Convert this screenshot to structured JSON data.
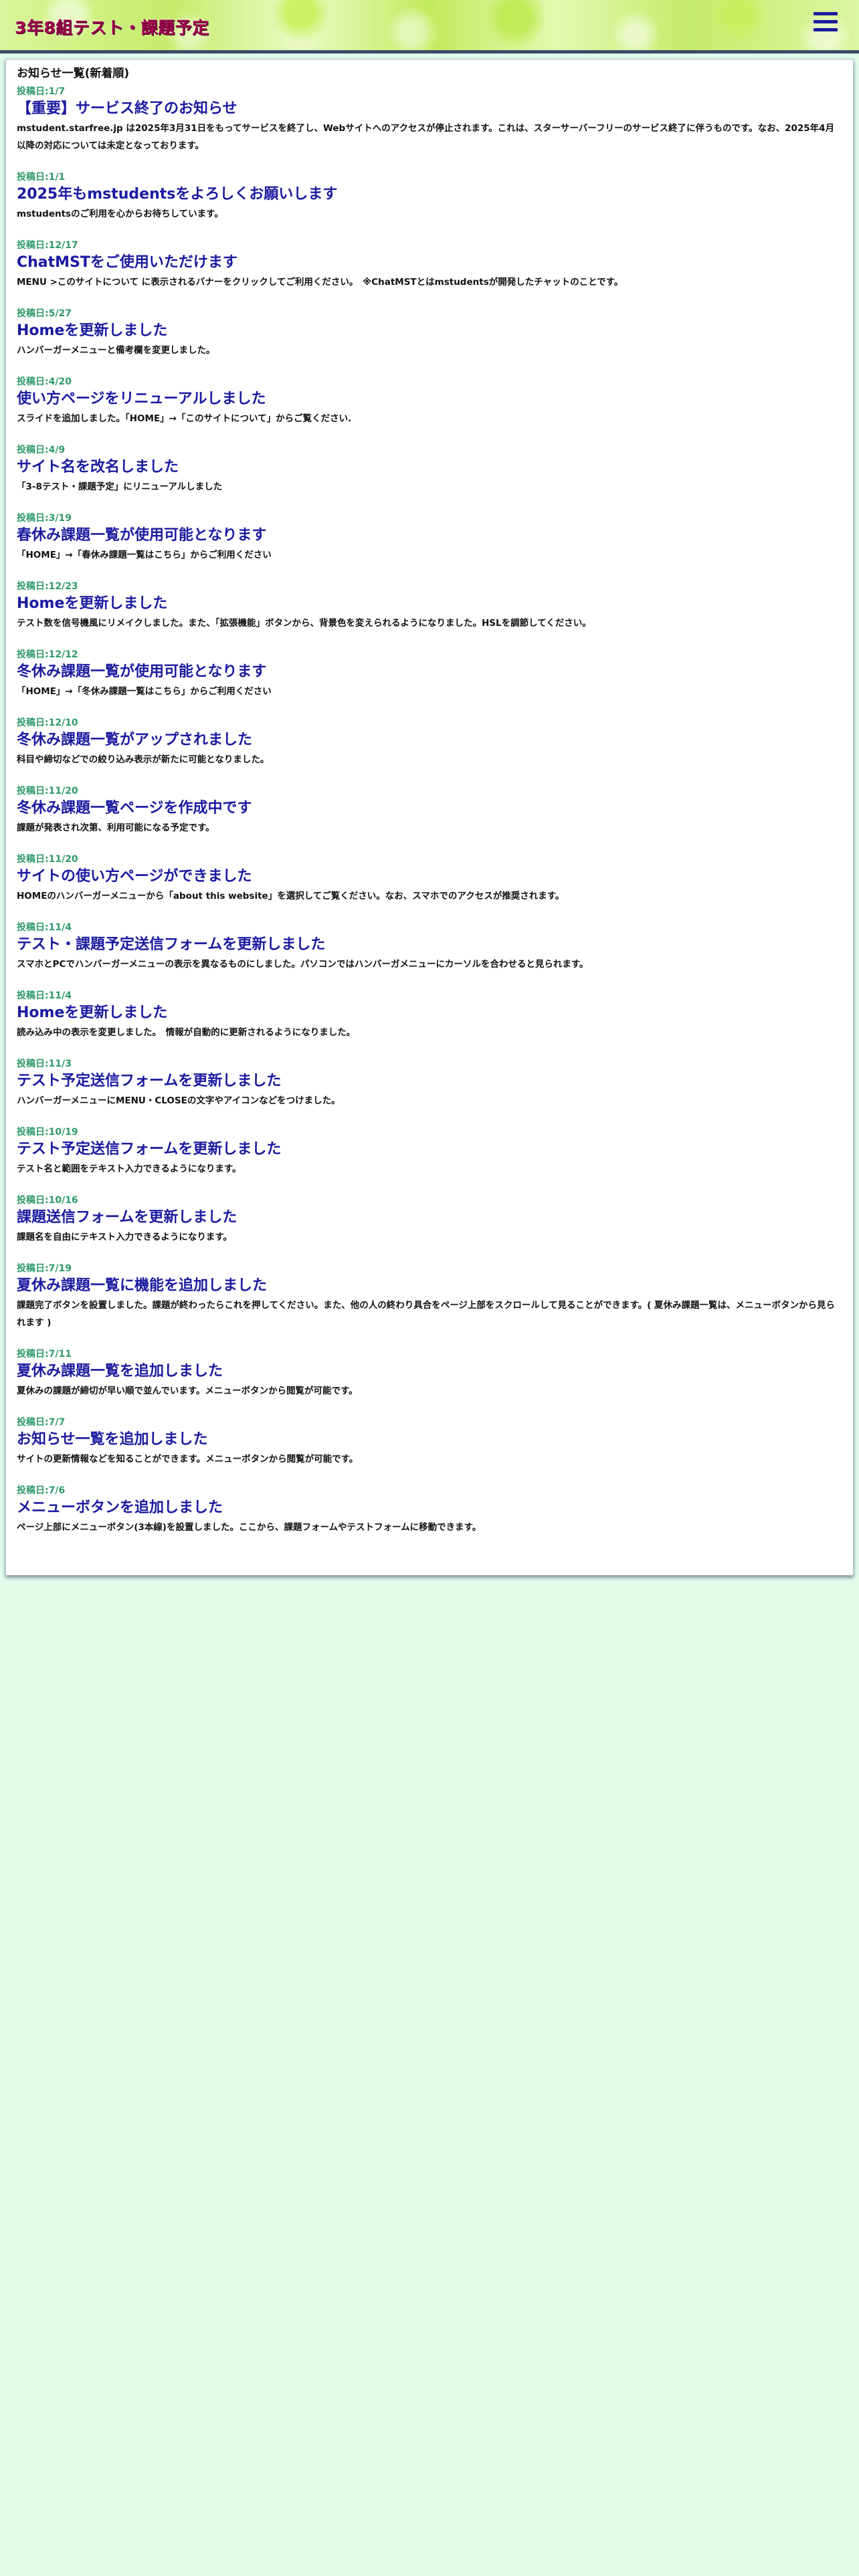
{
  "header": {
    "title": "3年8組テスト・課題予定",
    "menu_icon": "hamburger-menu-icon"
  },
  "colors": {
    "page_background": "#dffbea",
    "title_text": "#a0004c",
    "notice_title": "#1a1aa0",
    "date_text": "#2f9a6a",
    "header_border": "#3d4a6a"
  },
  "news": {
    "heading": "お知らせ一覧(新着順)",
    "items": [
      {
        "date": "投稿日:1/7",
        "title": "【重要】サービス終了のお知らせ",
        "body": "mstudent.starfree.jp は2025年3月31日をもってサービスを終了し、Webサイトへのアクセスが停止されます。これは、スターサーバーフリーのサービス終了に伴うものです。なお、2025年4月以降の対応については未定となっております。"
      },
      {
        "date": "投稿日:1/1",
        "title": "2025年もmstudentsをよろしくお願いします",
        "body": "mstudentsのご利用を心からお待ちしています。"
      },
      {
        "date": "投稿日:12/17",
        "title": "ChatMSTをご使用いただけます",
        "body": "MENU >このサイトについて に表示されるバナーをクリックしてご利用ください。　※ChatMSTとはmstudentsが開発したチャットのことです。"
      },
      {
        "date": "投稿日:5/27",
        "title": "Homeを更新しました",
        "body": "ハンバーガーメニューと備考欄を変更しました。"
      },
      {
        "date": "投稿日:4/20",
        "title": "使い方ページをリニューアルしました",
        "body": "スライドを追加しました。「HOME」→「このサイトについて」からご覧ください."
      },
      {
        "date": "投稿日:4/9",
        "title": "サイト名を改名しました",
        "body": "「3-8テスト・課題予定」にリニューアルしました"
      },
      {
        "date": "投稿日:3/19",
        "title": "春休み課題一覧が使用可能となります",
        "body": "「HOME」→「春休み課題一覧はこちら」からご利用ください"
      },
      {
        "date": "投稿日:12/23",
        "title": "Homeを更新しました",
        "body": "テスト数を信号機風にリメイクしました。また、「拡張機能」ボタンから、背景色を変えられるようになりました。HSLを調節してください。"
      },
      {
        "date": "投稿日:12/12",
        "title": "冬休み課題一覧が使用可能となります",
        "body": "「HOME」→「冬休み課題一覧はこちら」からご利用ください"
      },
      {
        "date": "投稿日:12/10",
        "title": "冬休み課題一覧がアップされました",
        "body": "科目や締切などでの絞り込み表示が新たに可能となりました。"
      },
      {
        "date": "投稿日:11/20",
        "title": "冬休み課題一覧ページを作成中です",
        "body": "課題が発表され次第、利用可能になる予定です。"
      },
      {
        "date": "投稿日:11/20",
        "title": "サイトの使い方ページができました",
        "body": "HOMEのハンバーガーメニューから「about this website」を選択してご覧ください。なお、スマホでのアクセスが推奨されます。"
      },
      {
        "date": "投稿日:11/4",
        "title": "テスト・課題予定送信フォームを更新しました",
        "body": "スマホとPCでハンバーガーメニューの表示を異なるものにしました。パソコンではハンバーガメニューにカーソルを合わせると見られます。"
      },
      {
        "date": "投稿日:11/4",
        "title": "Homeを更新しました",
        "body": "読み込み中の表示を変更しました。　情報が自動的に更新されるようになりました。"
      },
      {
        "date": "投稿日:11/3",
        "title": "テスト予定送信フォームを更新しました",
        "body": "ハンバーガーメニューにMENU・CLOSEの文字やアイコンなどをつけました。"
      },
      {
        "date": "投稿日:10/19",
        "title": "テスト予定送信フォームを更新しました",
        "body": "テスト名と範囲をテキスト入力できるようになります。"
      },
      {
        "date": "投稿日:10/16",
        "title": "課題送信フォームを更新しました",
        "body": "課題名を自由にテキスト入力できるようになります。"
      },
      {
        "date": "投稿日:7/19",
        "title": "夏休み課題一覧に機能を追加しました",
        "body": "課題完了ボタンを設置しました。課題が終わったらこれを押してください。また、他の人の終わり具合をページ上部をスクロールして見ることができます。( 夏休み課題一覧は、メニューボタンから見られます )"
      },
      {
        "date": "投稿日:7/11",
        "title": "夏休み課題一覧を追加しました",
        "body": "夏休みの課題が締切が早い順で並んでいます。メニューボタンから閲覧が可能です。"
      },
      {
        "date": "投稿日:7/7",
        "title": "お知らせ一覧を追加しました",
        "body": "サイトの更新情報などを知ることができます。メニューボタンから閲覧が可能です。"
      },
      {
        "date": "投稿日:7/6",
        "title": "メニューボタンを追加しました",
        "body": "ページ上部にメニューボタン(3本線)を設置しました。ここから、課題フォームやテストフォームに移動できます。"
      }
    ]
  }
}
